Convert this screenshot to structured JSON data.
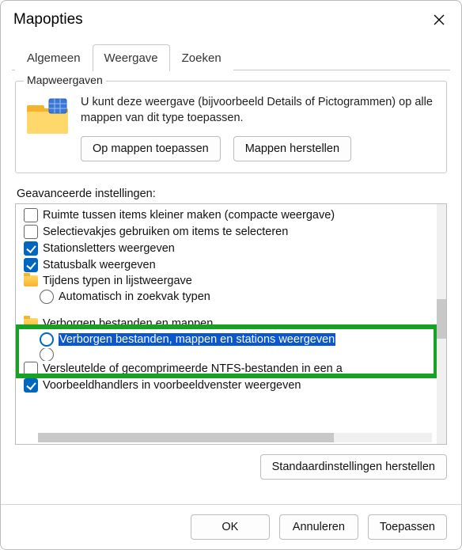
{
  "window": {
    "title": "Mapopties"
  },
  "tabs": {
    "general": "Algemeen",
    "view": "Weergave",
    "search": "Zoeken"
  },
  "folderViews": {
    "title": "Mapweergaven",
    "desc": "U kunt deze weergave (bijvoorbeeld Details of Pictogrammen) op alle mappen van dit type toepassen.",
    "apply": "Op mappen toepassen",
    "reset": "Mappen herstellen"
  },
  "advanced": {
    "label": "Geavanceerde instellingen:",
    "items": {
      "compact": "Ruimte tussen items kleiner maken (compacte weergave)",
      "checkboxes": "Selectievakjes gebruiken om items te selecteren",
      "driveletters": "Stationsletters weergeven",
      "statusbar": "Statusbalk weergeven",
      "typeahead_group": "Tijdens typen in lijstweergave",
      "typeahead_auto": "Automatisch in zoekvak typen",
      "hidden_group": "Verborgen bestanden en mappen",
      "hidden_show": "Verborgen bestanden, mappen en stations weergeven",
      "encrypted": "Versleutelde of gecomprimeerde NTFS-bestanden in een a",
      "preview": "Voorbeeldhandlers in voorbeeldvenster weergeven"
    },
    "restore": "Standaardinstellingen herstellen"
  },
  "footer": {
    "ok": "OK",
    "cancel": "Annuleren",
    "apply": "Toepassen"
  }
}
